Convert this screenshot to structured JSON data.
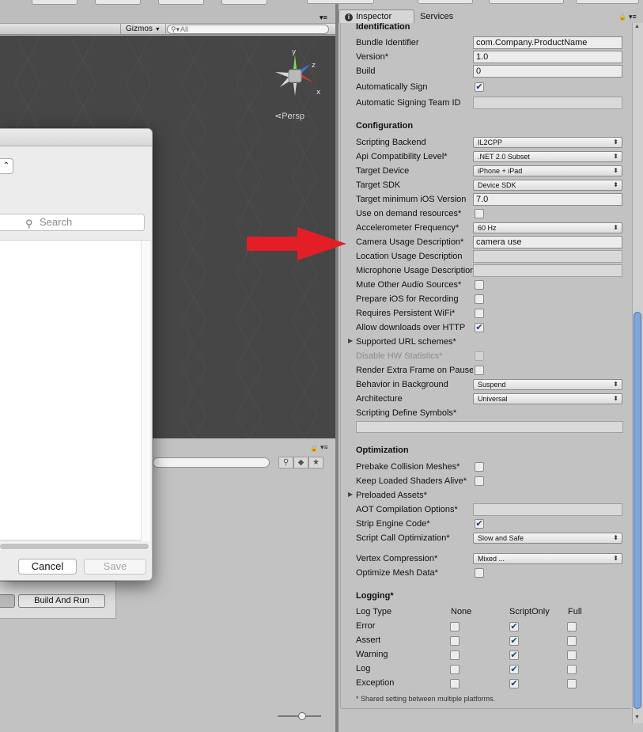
{
  "scene": {
    "gizmos_label": "Gizmos",
    "search_placeholder": "All",
    "persp_label": "Persp",
    "axis_y": "y",
    "axis_z": "z",
    "axis_x": "x"
  },
  "dialog": {
    "search_placeholder": "Search",
    "cancel_label": "Cancel",
    "save_label": "Save"
  },
  "build": {
    "build_and_run_label": "Build And Run"
  },
  "inspector": {
    "tab_inspector": "Inspector",
    "tab_services": "Services",
    "identification": {
      "header": "Identification",
      "bundle_identifier_label": "Bundle Identifier",
      "bundle_identifier_value": "com.Company.ProductName",
      "version_label": "Version*",
      "version_value": "1.0",
      "build_label": "Build",
      "build_value": "0",
      "auto_sign_label": "Automatically Sign",
      "auto_sign_checked": true,
      "team_id_label": "Automatic Signing Team ID",
      "team_id_value": ""
    },
    "configuration": {
      "header": "Configuration",
      "scripting_backend_label": "Scripting Backend",
      "scripting_backend_value": "IL2CPP",
      "api_compat_label": "Api Compatibility Level*",
      "api_compat_value": ".NET 2.0 Subset",
      "target_device_label": "Target Device",
      "target_device_value": "iPhone + iPad",
      "target_sdk_label": "Target SDK",
      "target_sdk_value": "Device SDK",
      "min_ios_label": "Target minimum iOS Version",
      "min_ios_value": "7.0",
      "on_demand_label": "Use on demand resources*",
      "accelerometer_label": "Accelerometer Frequency*",
      "accelerometer_value": "60 Hz",
      "camera_usage_label": "Camera Usage Description*",
      "camera_usage_value": "camera use",
      "location_usage_label": "Location Usage Description",
      "location_usage_value": "",
      "microphone_usage_label": "Microphone Usage Description",
      "microphone_usage_value": "",
      "mute_audio_label": "Mute Other Audio Sources*",
      "prepare_recording_label": "Prepare iOS for Recording",
      "persistent_wifi_label": "Requires Persistent WiFi*",
      "allow_http_label": "Allow downloads over HTTP",
      "url_schemes_label": "Supported URL schemes*",
      "disable_hw_stats_label": "Disable HW Statistics*",
      "render_extra_frame_label": "Render Extra Frame on Pause",
      "behavior_bg_label": "Behavior in Background",
      "behavior_bg_value": "Suspend",
      "architecture_label": "Architecture",
      "architecture_value": "Universal",
      "define_symbols_label": "Scripting Define Symbols*",
      "define_symbols_value": ""
    },
    "optimization": {
      "header": "Optimization",
      "prebake_label": "Prebake Collision Meshes*",
      "keep_shaders_label": "Keep Loaded Shaders Alive*",
      "preloaded_assets_label": "Preloaded Assets*",
      "aot_label": "AOT Compilation Options*",
      "aot_value": "",
      "strip_engine_label": "Strip Engine Code*",
      "script_call_label": "Script Call Optimization*",
      "script_call_value": "Slow and Safe",
      "vertex_compression_label": "Vertex Compression*",
      "vertex_compression_value": "Mixed ...",
      "optimize_mesh_label": "Optimize Mesh Data*"
    },
    "logging": {
      "header": "Logging*",
      "col_type": "Log Type",
      "col_none": "None",
      "col_script_only": "ScriptOnly",
      "col_full": "Full",
      "rows": [
        {
          "label": "Error",
          "value": "ScriptOnly"
        },
        {
          "label": "Assert",
          "value": "ScriptOnly"
        },
        {
          "label": "Warning",
          "value": "ScriptOnly"
        },
        {
          "label": "Log",
          "value": "ScriptOnly"
        },
        {
          "label": "Exception",
          "value": "ScriptOnly"
        }
      ]
    },
    "footnote": "* Shared setting between multiple platforms."
  },
  "colors": {
    "arrow": "#e41e26",
    "scroll_thumb": "#7fa5df",
    "scene_bg": "#464646"
  }
}
